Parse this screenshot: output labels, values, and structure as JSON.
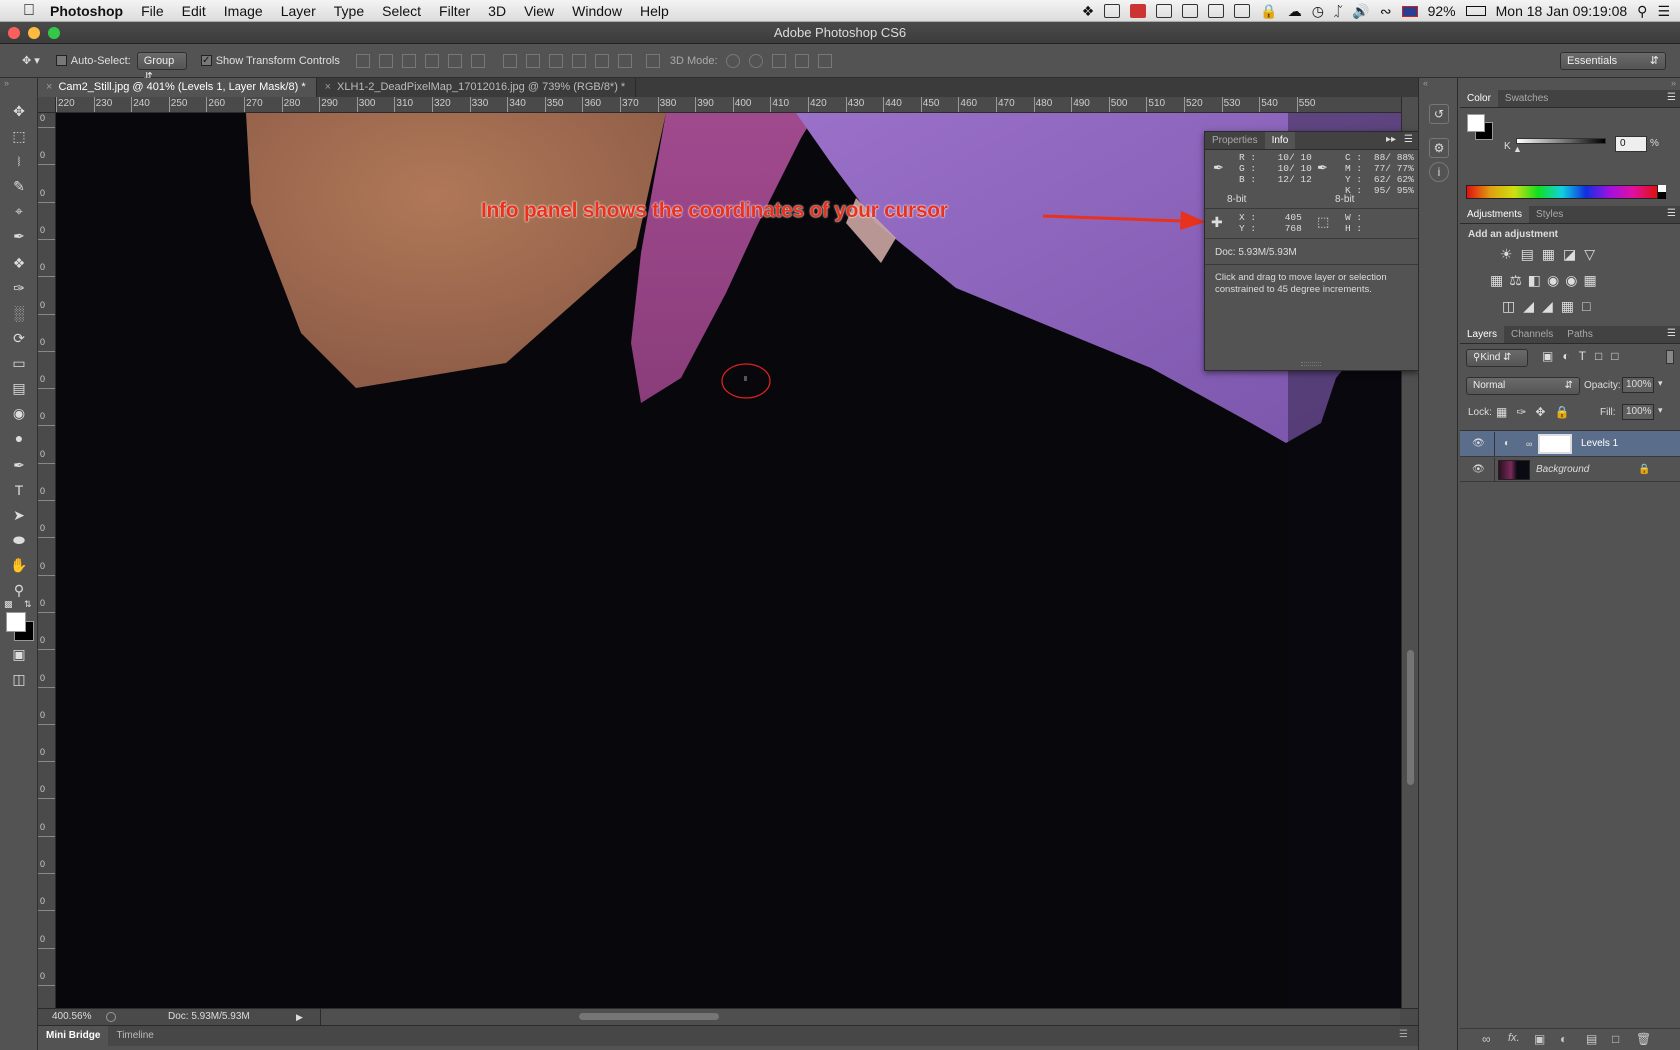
{
  "menubar": {
    "app_name": "Photoshop",
    "items": [
      "File",
      "Edit",
      "Image",
      "Layer",
      "Type",
      "Select",
      "Filter",
      "3D",
      "View",
      "Window",
      "Help"
    ],
    "battery": "92%",
    "datetime": "Mon 18 Jan  09:19:08"
  },
  "window": {
    "title": "Adobe Photoshop CS6"
  },
  "options": {
    "auto_select_label": "Auto-Select:",
    "auto_select_value": "Group",
    "show_transform_label": "Show Transform Controls",
    "mode_3d_label": "3D Mode:",
    "workspace": "Essentials"
  },
  "tabs": [
    {
      "label": "Cam2_Still.jpg @ 401% (Levels 1, Layer Mask/8) *"
    },
    {
      "label": "XLH1-2_DeadPixelMap_17012016.jpg @ 739% (RGB/8*) *"
    }
  ],
  "rulers": {
    "horizontal": [
      "220",
      "230",
      "240",
      "250",
      "260",
      "270",
      "280",
      "290",
      "300",
      "310",
      "320",
      "330",
      "340",
      "350",
      "360",
      "370",
      "380",
      "390",
      "400",
      "410",
      "420",
      "430",
      "440",
      "450",
      "460",
      "470",
      "480",
      "490",
      "500",
      "510",
      "520",
      "530",
      "540",
      "550"
    ],
    "vertical": [
      "0",
      "0",
      "0",
      "0",
      "0",
      "0",
      "0",
      "0",
      "0",
      "0",
      "0",
      "0",
      "0",
      "0",
      "0",
      "0",
      "0",
      "0",
      "0",
      "0",
      "0",
      "0",
      "0",
      "0",
      "0"
    ]
  },
  "annotation": {
    "text": "Info panel shows the coordinates of your cursor",
    "color": "#e8321e"
  },
  "info_panel": {
    "tabs": [
      "Properties",
      "Info"
    ],
    "rgb": {
      "r_label": "R :",
      "r_value": "10/  10",
      "g_label": "G :",
      "g_value": "10/  10",
      "b_label": "B :",
      "b_value": "12/  12",
      "bit": "8-bit"
    },
    "cmyk": {
      "c_label": "C :",
      "c_value": "88/  88%",
      "m_label": "M :",
      "m_value": "77/  77%",
      "y_label": "Y :",
      "y_value": "62/  62%",
      "k_label": "K :",
      "k_value": "95/  95%",
      "bit": "8-bit"
    },
    "coords": {
      "x_label": "X :",
      "x_value": "405",
      "y_label": "Y :",
      "y_value": "768"
    },
    "size": {
      "w_label": "W :",
      "h_label": "H :"
    },
    "doc": "Doc: 5.93M/5.93M",
    "hint": "Click and drag to move layer or selection constrained to 45 degree increments."
  },
  "status": {
    "zoom": "400.56%",
    "doc": "Doc: 5.93M/5.93M"
  },
  "bottom_tabs": [
    "Mini Bridge",
    "Timeline"
  ],
  "color_panel": {
    "tabs": [
      "Color",
      "Swatches"
    ],
    "k_label": "K",
    "k_value": "0",
    "unit": "%"
  },
  "adjustments_panel": {
    "tabs": [
      "Adjustments",
      "Styles"
    ],
    "heading": "Add an adjustment"
  },
  "layers_panel": {
    "tabs": [
      "Layers",
      "Channels",
      "Paths"
    ],
    "kind": "Kind",
    "blend_mode": "Normal",
    "opacity_label": "Opacity:",
    "opacity_value": "100%",
    "lock_label": "Lock:",
    "fill_label": "Fill:",
    "fill_value": "100%",
    "layers": [
      {
        "name": "Levels 1"
      },
      {
        "name": "Background"
      }
    ]
  }
}
